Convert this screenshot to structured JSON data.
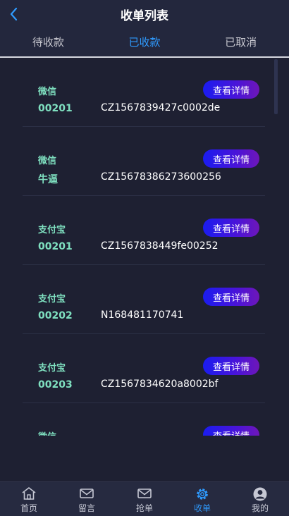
{
  "header": {
    "title": "收单列表",
    "tabs": [
      "待收款",
      "已收款",
      "已取消"
    ]
  },
  "orders": [
    {
      "method": "微信",
      "channel": "00201",
      "order_no": "CZ1567839427c0002de",
      "button": "查看详情"
    },
    {
      "method": "微信",
      "channel": "牛逼",
      "order_no": "CZ15678386273600256",
      "button": "查看详情"
    },
    {
      "method": "支付宝",
      "channel": "00201",
      "order_no": "CZ1567838449fe00252",
      "button": "查看详情"
    },
    {
      "method": "支付宝",
      "channel": "00202",
      "order_no": "N168481170741",
      "button": "查看详情"
    },
    {
      "method": "支付宝",
      "channel": "00203",
      "order_no": "CZ1567834620a8002bf",
      "button": "查看详情"
    },
    {
      "method": "微信",
      "channel": "",
      "order_no": "",
      "button": "查看详情"
    }
  ],
  "tabbar": [
    {
      "label": "首页",
      "icon": "home-icon"
    },
    {
      "label": "留言",
      "icon": "mail-icon"
    },
    {
      "label": "抢单",
      "icon": "mail-icon"
    },
    {
      "label": "收单",
      "icon": "gear-icon"
    },
    {
      "label": "我的",
      "icon": "user-icon"
    }
  ],
  "colors": {
    "accent": "#2f9bff",
    "label_green": "#7fe0c0",
    "button_gradient_start": "#1a1cf0",
    "button_gradient_end": "#6e16b8"
  }
}
